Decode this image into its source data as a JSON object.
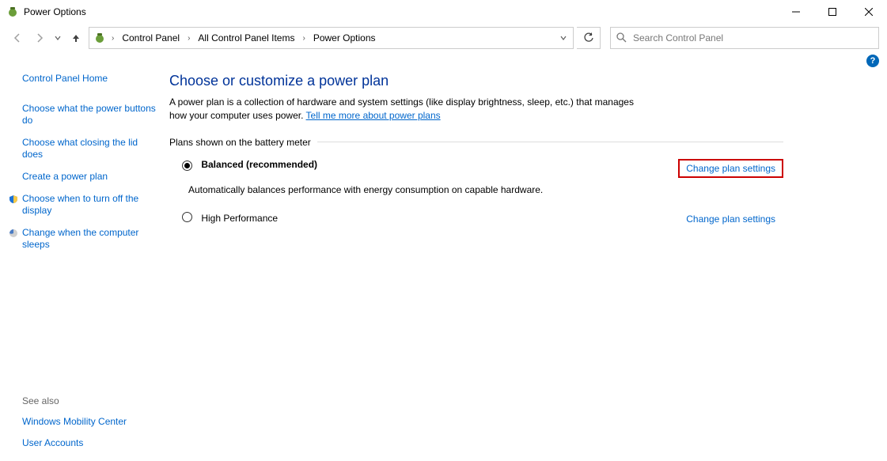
{
  "window": {
    "title": "Power Options"
  },
  "breadcrumbs": {
    "root": "Control Panel",
    "mid": "All Control Panel Items",
    "leaf": "Power Options"
  },
  "search": {
    "placeholder": "Search Control Panel"
  },
  "sidebar": {
    "home": "Control Panel Home",
    "links": [
      "Choose what the power buttons do",
      "Choose what closing the lid does",
      "Create a power plan",
      "Choose when to turn off the display",
      "Change when the computer sleeps"
    ],
    "see_also_label": "See also",
    "see_also": [
      "Windows Mobility Center",
      "User Accounts"
    ]
  },
  "main": {
    "title": "Choose or customize a power plan",
    "desc_prefix": "A power plan is a collection of hardware and system settings (like display brightness, sleep, etc.) that manages how your computer uses power. ",
    "desc_link": "Tell me more about power plans",
    "section_label": "Plans shown on the battery meter",
    "plans": [
      {
        "name": "Balanced (recommended)",
        "desc": "Automatically balances performance with energy consumption on capable hardware.",
        "change_label": "Change plan settings",
        "selected": true,
        "highlighted": true
      },
      {
        "name": "High Performance",
        "desc": "",
        "change_label": "Change plan settings",
        "selected": false,
        "highlighted": false
      }
    ]
  }
}
